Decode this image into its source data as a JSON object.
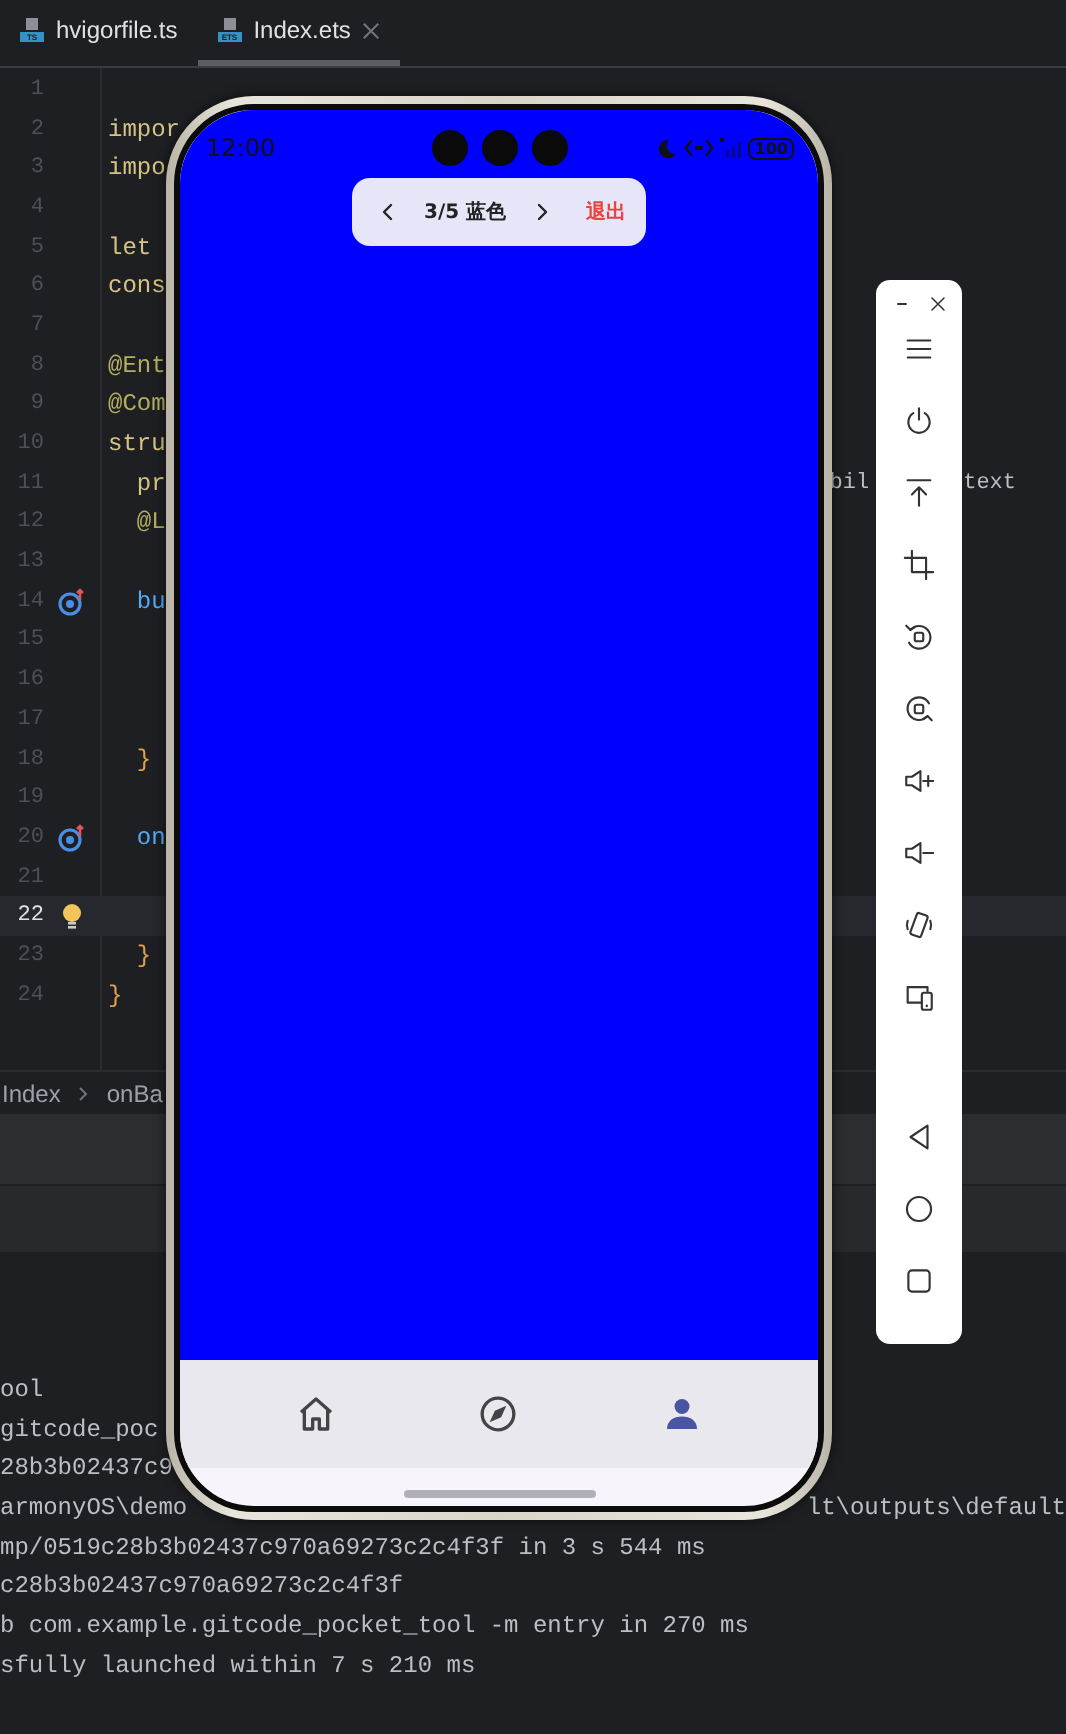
{
  "editor_tabs": [
    {
      "label": "hvigorfile.ts",
      "file_badge": "TS",
      "selected": false,
      "closable": false
    },
    {
      "label": "Index.ets",
      "file_badge": "ETS",
      "selected": true,
      "closable": true
    }
  ],
  "code_lines": [
    {
      "number": "1",
      "current": false,
      "override": false,
      "hint": false
    },
    {
      "number": "2",
      "text": "impor",
      "kind": "keyword",
      "current": false,
      "override": false,
      "hint": false
    },
    {
      "number": "3",
      "text": "impo",
      "kind": "keyword",
      "current": false,
      "override": false,
      "hint": false
    },
    {
      "number": "4",
      "current": false,
      "override": false,
      "hint": false
    },
    {
      "number": "5",
      "text": "let",
      "kind": "keyword",
      "current": false,
      "override": false,
      "hint": false
    },
    {
      "number": "6",
      "text": "cons",
      "kind": "keyword",
      "current": false,
      "override": false,
      "hint": false
    },
    {
      "number": "7",
      "current": false,
      "override": false,
      "hint": false
    },
    {
      "number": "8",
      "text": "@Ent",
      "kind": "decorator",
      "current": false,
      "override": false,
      "hint": false
    },
    {
      "number": "9",
      "text": "@Com",
      "kind": "decorator",
      "current": false,
      "override": false,
      "hint": false
    },
    {
      "number": "10",
      "text": "stru",
      "kind": "keyword",
      "current": false,
      "override": false,
      "hint": false
    },
    {
      "number": "11",
      "text": "  pr",
      "kind": "keyword",
      "right_fragments": [
        "bil",
        "text"
      ],
      "current": false,
      "override": false,
      "hint": false
    },
    {
      "number": "12",
      "text": "  @L",
      "kind": "decorator",
      "current": false,
      "override": false,
      "hint": false
    },
    {
      "number": "13",
      "current": false,
      "override": false,
      "hint": false
    },
    {
      "number": "14",
      "text": "  bu",
      "kind": "method",
      "current": false,
      "override": true,
      "hint": false
    },
    {
      "number": "15",
      "current": false,
      "override": false,
      "hint": false
    },
    {
      "number": "16",
      "current": false,
      "override": false,
      "hint": false
    },
    {
      "number": "17",
      "current": false,
      "override": false,
      "hint": false
    },
    {
      "number": "18",
      "text": "  }",
      "kind": "brace",
      "current": false,
      "override": false,
      "hint": false
    },
    {
      "number": "19",
      "current": false,
      "override": false,
      "hint": false
    },
    {
      "number": "20",
      "text": "  on",
      "kind": "method",
      "current": false,
      "override": true,
      "hint": false
    },
    {
      "number": "21",
      "current": false,
      "override": false,
      "hint": false
    },
    {
      "number": "22",
      "current": true,
      "override": false,
      "hint": true
    },
    {
      "number": "23",
      "text": "  }",
      "kind": "brace",
      "current": false,
      "override": false,
      "hint": false
    },
    {
      "number": "24",
      "text": "}",
      "kind": "brace",
      "current": false,
      "override": false,
      "hint": false
    }
  ],
  "breadcrumb": [
    "Index",
    "onBa"
  ],
  "console_lines": [
    {
      "text": "ool"
    },
    {
      "text": "gitcode_poc"
    },
    {
      "text": "28b3b02437c9"
    },
    {
      "text": "armonyOS\\demo",
      "right": "lt\\outputs\\default"
    },
    {
      "text": "mp/0519c28b3b02437c970a69273c2c4f3f in 3 s 544 ms"
    },
    {
      "text": "c28b3b02437c970a69273c2c4f3f"
    },
    {
      "text": "b com.example.gitcode_pocket_tool -m entry in 270 ms"
    },
    {
      "text": "sfully launched within 7 s 210 ms"
    }
  ],
  "phone": {
    "status_bar": {
      "time": "12:00",
      "battery": "100"
    },
    "pager": {
      "counter": "3/5 蓝色",
      "exit_label": "退出"
    },
    "bottom_nav": [
      {
        "kind": "home",
        "selected": false
      },
      {
        "kind": "compass",
        "selected": false
      },
      {
        "kind": "profile",
        "selected": true
      }
    ]
  }
}
